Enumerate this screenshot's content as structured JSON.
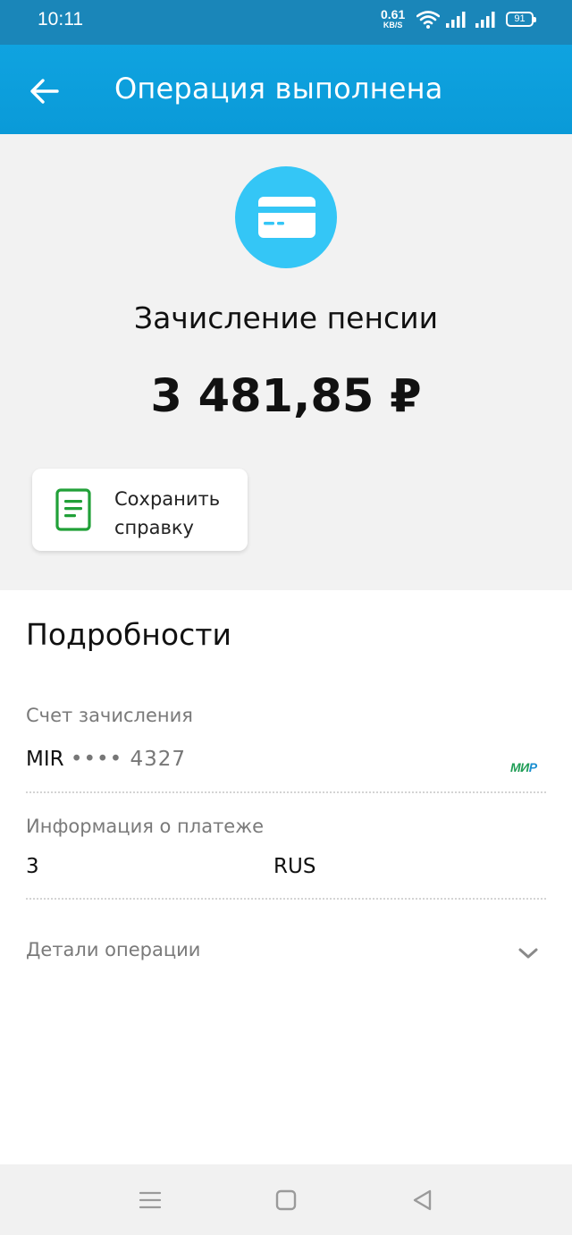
{
  "status_bar": {
    "time": "10:11",
    "net_speed_value": "0.61",
    "net_speed_unit": "KB/S",
    "battery": "91",
    "icons": [
      "wifi-icon",
      "signal-icon",
      "signal-icon",
      "battery-icon"
    ]
  },
  "app_bar": {
    "title": "Операция выполнена",
    "back_icon": "arrow-left-icon"
  },
  "operation": {
    "icon": "credit-card-icon",
    "title": "Зачисление пенсии",
    "amount": "3 481,85 ₽",
    "save_button": {
      "icon": "document-icon",
      "line1": "Сохранить",
      "line2": "справку"
    }
  },
  "details": {
    "title": "Подробности",
    "account": {
      "label": "Счет зачисления",
      "card_brand": "MIR",
      "card_masked": "•••• 4327",
      "logo_text_main": "МИ",
      "logo_text_accent": "Р"
    },
    "payment_info": {
      "label": "Информация о платеже",
      "value_left": "3",
      "value_right": "RUS"
    },
    "operation_details": {
      "label": "Детали операции",
      "icon": "chevron-down-icon"
    }
  },
  "nav_bar": {
    "icons": [
      "menu-icon",
      "home-square-icon",
      "back-triangle-icon"
    ]
  },
  "colors": {
    "status_bar": "#1a86b9",
    "app_bar": "#0fa3e0",
    "accent_circle": "#34c6f6",
    "doc_icon_green": "#21a038"
  }
}
